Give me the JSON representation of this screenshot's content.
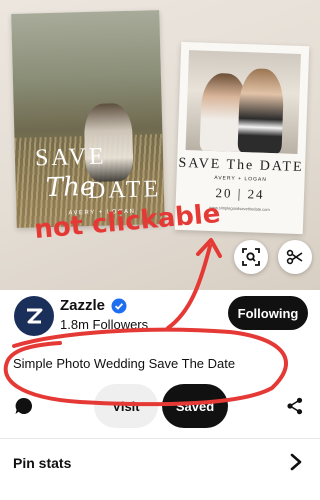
{
  "hero": {
    "card_left": {
      "line1": "SAVE",
      "line2": "The",
      "line3": "DATE",
      "names": "AVERY + LOGAN"
    },
    "card_right": {
      "line1": "SAVE The DATE",
      "names": "AVERY + LOGAN",
      "date": "20 | 24",
      "footer": "www.simplegoodsavethedate.com"
    },
    "lens_icon": "lens-icon",
    "scissors_icon": "scissors-icon"
  },
  "annotation": {
    "text": "not clickable",
    "color": "#e53935"
  },
  "creator": {
    "name": "Zazzle",
    "followers": "1.8m Followers",
    "verified_color": "#1d6ef0",
    "avatar_color": "#1a2f5a",
    "follow_button": "Following"
  },
  "pin": {
    "title": "Simple Photo Wedding  Save The Date"
  },
  "actions": {
    "visit_label": "Visit",
    "saved_label": "Saved",
    "comment_icon": "comment-icon",
    "share_icon": "share-icon"
  },
  "stats": {
    "label": "Pin stats",
    "chevron_icon": "chevron-right-icon"
  }
}
